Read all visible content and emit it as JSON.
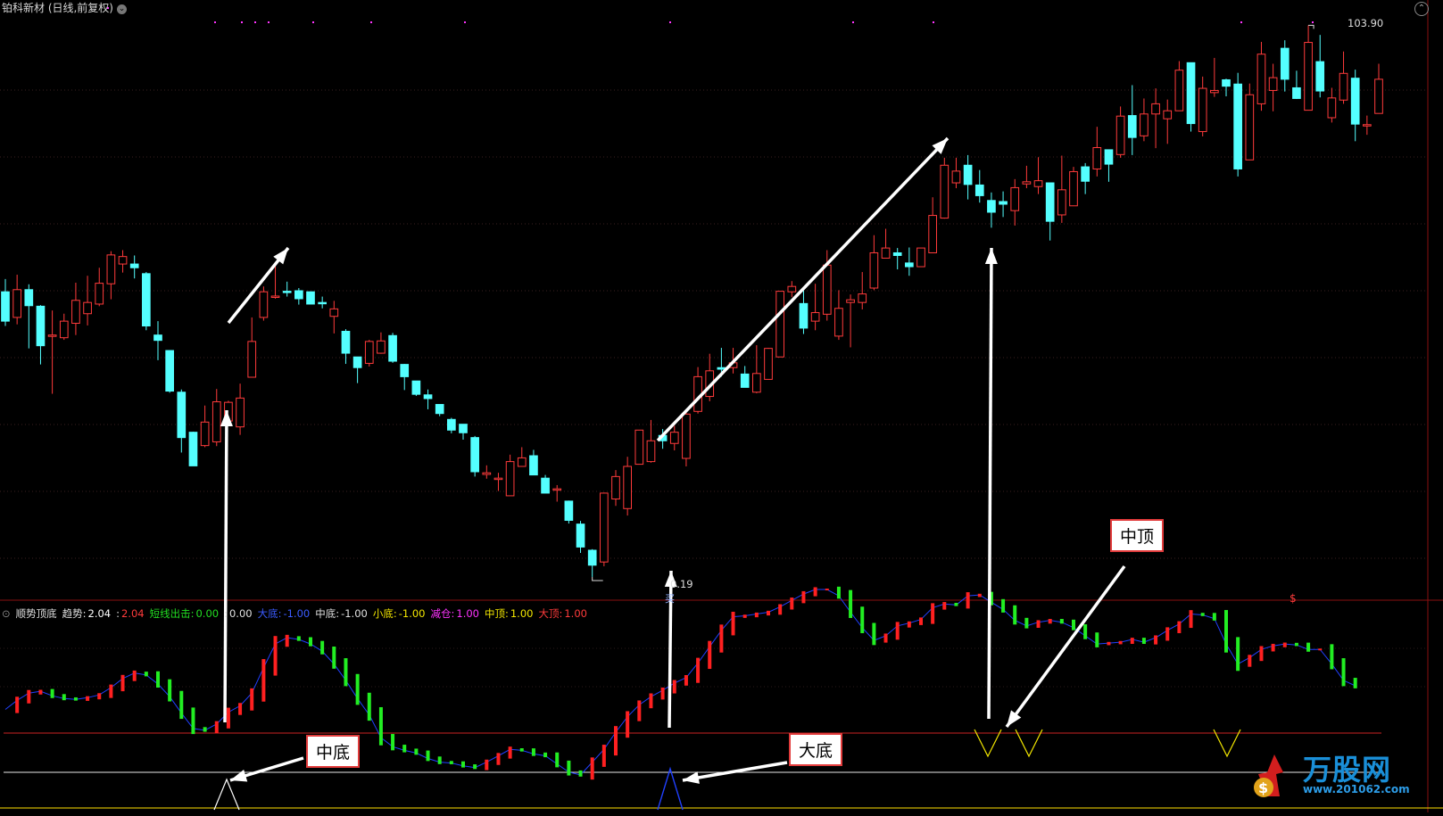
{
  "header": {
    "title": "铂科新材 (日线,前复权)",
    "max_price_label": "103.90",
    "min_price_label": "0.19"
  },
  "indicator": {
    "name": "顺势顶底",
    "items": [
      {
        "label": "趋势:",
        "value": "2.04",
        "label_color": "#e0e0e0",
        "value_color": "#ffffff"
      },
      {
        "label": ":",
        "value": "2.04",
        "label_color": "#e0e0e0",
        "value_color": "#ff3b3b"
      },
      {
        "label": "短线出击:",
        "value": "0.00",
        "label_color": "#22dd22",
        "value_color": "#22dd22"
      },
      {
        "label": ":",
        "value": "0.00",
        "label_color": "#e0e0e0",
        "value_color": "#e0e0e0"
      },
      {
        "label": "大底:",
        "value": "-1.00",
        "label_color": "#3b5bff",
        "value_color": "#3b5bff"
      },
      {
        "label": "中底:",
        "value": "-1.00",
        "label_color": "#e0e0e0",
        "value_color": "#e0e0e0"
      },
      {
        "label": "小底:",
        "value": "-1.00",
        "label_color": "#f2e600",
        "value_color": "#f2e600"
      },
      {
        "label": "减仓:",
        "value": "1.00",
        "label_color": "#ff33ff",
        "value_color": "#ff33ff"
      },
      {
        "label": "中顶:",
        "value": "1.00",
        "label_color": "#f2e600",
        "value_color": "#f2e600"
      },
      {
        "label": "大顶:",
        "value": "1.00",
        "label_color": "#ff3b3b",
        "value_color": "#ff3b3b"
      }
    ],
    "markers": {
      "dollar": "$",
      "buy": "买"
    }
  },
  "callouts": {
    "mid_bottom": "中底",
    "big_bottom": "大底",
    "mid_top": "中顶"
  },
  "watermark": {
    "brand": "万股网",
    "url": "www.201062.com"
  },
  "colors": {
    "up": "#ff3b3b",
    "down": "#54ffff",
    "trend_up": "#ff2020",
    "trend_down": "#22ee22",
    "trend_line": "#2040ff",
    "axis_line": "#cc2222",
    "big_bottom": "#2040ff",
    "mid_bottom": "#ffffff",
    "mid_top": "#f2e600"
  },
  "chart_data": [
    {
      "type": "candlestick",
      "series_note": "daily OHLC (price units, estimated)",
      "ylim": [
        0,
        104
      ],
      "max_price": 103.9,
      "min_price": 0.19,
      "candles": [
        [
          53.6,
          48.1,
          56.0,
          47.2
        ],
        [
          48.8,
          54.0,
          56.8,
          47.5
        ],
        [
          54.0,
          51.0,
          55.0,
          43.0
        ],
        [
          50.9,
          43.5,
          51.1,
          40.0
        ],
        [
          45.5,
          45.5,
          50.1,
          34.5
        ],
        [
          45.0,
          48.1,
          49.5,
          44.6
        ],
        [
          47.7,
          52.0,
          55.3,
          45.5
        ],
        [
          49.5,
          51.6,
          56.6,
          47.3
        ],
        [
          51.3,
          55.2,
          58.1,
          50.9
        ],
        [
          55.1,
          60.5,
          61.2,
          52.2
        ],
        [
          58.8,
          60.2,
          61.4,
          57.2
        ],
        [
          58.8,
          58.1,
          60.4,
          56.1
        ],
        [
          57.0,
          47.2,
          57.3,
          46.4
        ],
        [
          45.5,
          44.5,
          48.1,
          40.8
        ],
        [
          42.6,
          35.0,
          42.6,
          34.7
        ],
        [
          34.8,
          26.3,
          35.3,
          23.5
        ],
        [
          27.3,
          21.0,
          27.4,
          21.2
        ],
        [
          24.8,
          29.2,
          32.3,
          24.5
        ],
        [
          25.5,
          33.0,
          35.4,
          24.7
        ],
        [
          29.4,
          32.9,
          33.2,
          29.1
        ],
        [
          28.3,
          33.7,
          36.4,
          26.8
        ],
        [
          37.6,
          44.3,
          48.8,
          38.2
        ],
        [
          48.8,
          53.6,
          54.6,
          48.2
        ],
        [
          52.8,
          52.8,
          58.9,
          52.3
        ],
        [
          53.7,
          53.6,
          55.5,
          52.7
        ],
        [
          53.8,
          52.3,
          54.3,
          51.2
        ],
        [
          53.6,
          51.3,
          53.5,
          51.3
        ],
        [
          51.6,
          51.5,
          52.7,
          50.5
        ],
        [
          49.0,
          50.4,
          51.9,
          45.8
        ],
        [
          46.2,
          42.1,
          46.6,
          40.1
        ],
        [
          41.4,
          39.4,
          41.4,
          36.5
        ],
        [
          40.2,
          44.3,
          44.6,
          39.6
        ],
        [
          42.1,
          44.4,
          46.0,
          42.0
        ],
        [
          45.4,
          40.6,
          45.9,
          40.3
        ],
        [
          40.0,
          37.7,
          40.1,
          35.2
        ],
        [
          36.9,
          34.4,
          36.9,
          34.1
        ],
        [
          34.3,
          33.6,
          35.3,
          31.6
        ],
        [
          32.5,
          30.8,
          32.5,
          30.3
        ],
        [
          29.7,
          27.7,
          30.0,
          27.1
        ],
        [
          28.8,
          27.2,
          28.8,
          25.9
        ],
        [
          26.3,
          19.9,
          26.6,
          19.0
        ],
        [
          19.4,
          19.7,
          21.1,
          18.6
        ],
        [
          18.7,
          18.7,
          19.7,
          16.3
        ],
        [
          15.4,
          21.8,
          23.1,
          15.8
        ],
        [
          20.9,
          22.5,
          24.5,
          22.3
        ],
        [
          22.9,
          19.3,
          24.0,
          19.4
        ],
        [
          18.7,
          15.9,
          19.3,
          16.0
        ],
        [
          16.7,
          16.7,
          17.4,
          14.3
        ],
        [
          14.4,
          10.8,
          14.5,
          10.2
        ],
        [
          10.1,
          5.8,
          10.7,
          4.7
        ],
        [
          5.2,
          2.4,
          5.4,
          0.2
        ],
        [
          3.0,
          15.9,
          16.0,
          2.2
        ],
        [
          14.8,
          19.0,
          20.2,
          13.5
        ],
        [
          13.0,
          20.9,
          22.7,
          11.7
        ],
        [
          21.3,
          27.7,
          26.3,
          21.3
        ],
        [
          21.8,
          25.7,
          29.6,
          21.6
        ],
        [
          26.7,
          25.7,
          27.9,
          24.2
        ],
        [
          25.2,
          27.3,
          28.5,
          23.9
        ],
        [
          22.4,
          30.7,
          31.4,
          20.9
        ],
        [
          31.2,
          37.7,
          39.5,
          30.8
        ],
        [
          34.0,
          38.8,
          42.0,
          33.1
        ],
        [
          39.4,
          39.1,
          43.1,
          37.7
        ],
        [
          39.4,
          40.3,
          43.1,
          38.3
        ],
        [
          38.2,
          35.7,
          39.7,
          35.9
        ],
        [
          34.8,
          38.3,
          43.6,
          34.6
        ],
        [
          37.2,
          43.0,
          43.1,
          37.8
        ],
        [
          41.4,
          53.7,
          53.2,
          41.5
        ],
        [
          53.6,
          54.6,
          55.6,
          52.6
        ],
        [
          51.4,
          46.8,
          53.8,
          45.7
        ],
        [
          48.1,
          49.7,
          55.1,
          46.4
        ],
        [
          49.4,
          58.6,
          61.4,
          48.2
        ],
        [
          45.3,
          50.5,
          53.9,
          44.6
        ],
        [
          51.6,
          52.1,
          53.1,
          43.2
        ],
        [
          51.6,
          53.2,
          57.3,
          50.3
        ],
        [
          54.3,
          60.9,
          64.2,
          53.9
        ],
        [
          59.9,
          61.8,
          65.4,
          60.9
        ],
        [
          60.9,
          60.4,
          61.8,
          57.8
        ],
        [
          59.0,
          58.3,
          61.9,
          56.6
        ],
        [
          58.3,
          61.8,
          61.5,
          59.6
        ],
        [
          60.9,
          67.9,
          71.3,
          63.0
        ],
        [
          67.4,
          77.3,
          78.7,
          67.3
        ],
        [
          74.0,
          76.2,
          78.7,
          73.0
        ],
        [
          77.3,
          73.7,
          79.2,
          70.9
        ],
        [
          73.6,
          71.6,
          76.4,
          70.3
        ],
        [
          70.7,
          68.5,
          72.2,
          65.6
        ],
        [
          70.5,
          70.0,
          72.4,
          67.6
        ],
        [
          68.8,
          73.1,
          74.7,
          66.0
        ],
        [
          73.8,
          74.2,
          77.2,
          73.0
        ],
        [
          73.3,
          74.4,
          78.8,
          71.9
        ],
        [
          74.0,
          66.8,
          74.0,
          63.2
        ],
        [
          68.0,
          72.7,
          79.1,
          66.5
        ],
        [
          69.7,
          76.1,
          77.0,
          70.7
        ],
        [
          77.0,
          74.3,
          77.7,
          71.9
        ],
        [
          76.6,
          80.6,
          84.5,
          75.2
        ],
        [
          80.2,
          77.5,
          79.3,
          74.2
        ],
        [
          79.3,
          86.5,
          88.3,
          78.7
        ],
        [
          86.6,
          82.5,
          92.3,
          79.2
        ],
        [
          82.8,
          86.9,
          89.8,
          81.8
        ],
        [
          86.9,
          88.8,
          91.7,
          80.5
        ],
        [
          86.0,
          87.5,
          89.6,
          81.3
        ],
        [
          87.5,
          95.1,
          96.8,
          87.5
        ],
        [
          96.5,
          85.1,
          96.2,
          83.6
        ],
        [
          83.6,
          91.7,
          93.9,
          82.7
        ],
        [
          90.9,
          91.3,
          97.4,
          90.1
        ],
        [
          93.3,
          92.1,
          93.5,
          90.2
        ],
        [
          92.5,
          76.6,
          94.6,
          75.2
        ],
        [
          78.3,
          90.5,
          92.6,
          78.8
        ],
        [
          88.8,
          98.1,
          100.4,
          87.5
        ],
        [
          91.3,
          93.7,
          96.3,
          87.4
        ],
        [
          99.2,
          93.4,
          100.7,
          91.1
        ],
        [
          91.8,
          89.8,
          95.0,
          89.7
        ],
        [
          87.6,
          100.3,
          103.5,
          90.5
        ],
        [
          96.7,
          91.2,
          101.7,
          90.0
        ],
        [
          86.2,
          89.9,
          91.8,
          85.3
        ],
        [
          89.5,
          94.5,
          98.6,
          88.8
        ],
        [
          93.6,
          85.0,
          95.2,
          81.8
        ],
        [
          84.9,
          84.9,
          86.6,
          83.0
        ],
        [
          87.0,
          93.4,
          96.3,
          88.2
        ]
      ]
    },
    {
      "type": "line",
      "name": "趋势",
      "ylim": [
        -1,
        2.6
      ],
      "values": [
        0.26,
        0.36,
        0.44,
        0.46,
        0.41,
        0.38,
        0.37,
        0.39,
        0.42,
        0.5,
        0.6,
        0.66,
        0.64,
        0.54,
        0.4,
        0.22,
        0.05,
        0.03,
        0.1,
        0.23,
        0.3,
        0.44,
        0.72,
        0.98,
        1.05,
        1.03,
        0.98,
        0.9,
        0.76,
        0.58,
        0.38,
        0.2,
        -0.05,
        -0.15,
        -0.19,
        -0.22,
        -0.28,
        -0.32,
        -0.33,
        -0.36,
        -0.38,
        -0.32,
        -0.25,
        -0.18,
        -0.19,
        -0.23,
        -0.25,
        -0.34,
        -0.43,
        -0.46,
        -0.32,
        -0.18,
        0.01,
        0.18,
        0.31,
        0.4,
        0.47,
        0.55,
        0.61,
        0.77,
        0.95,
        1.13,
        1.28,
        1.29,
        1.31,
        1.33,
        1.39,
        1.46,
        1.53,
        1.58,
        1.58,
        1.51,
        1.33,
        1.16,
        1.02,
        1.07,
        1.18,
        1.21,
        1.25,
        1.38,
        1.42,
        1.41,
        1.51,
        1.52,
        1.44,
        1.36,
        1.24,
        1.18,
        1.22,
        1.24,
        1.22,
        1.16,
        1.07,
        0.98,
        0.99,
        1.0,
        1.03,
        1.0,
        1.05,
        1.13,
        1.2,
        1.31,
        1.3,
        1.26,
        0.98,
        0.76,
        0.83,
        0.92,
        0.96,
        0.98,
        0.97,
        0.92,
        0.92,
        0.76,
        0.58,
        0.52
      ]
    }
  ]
}
